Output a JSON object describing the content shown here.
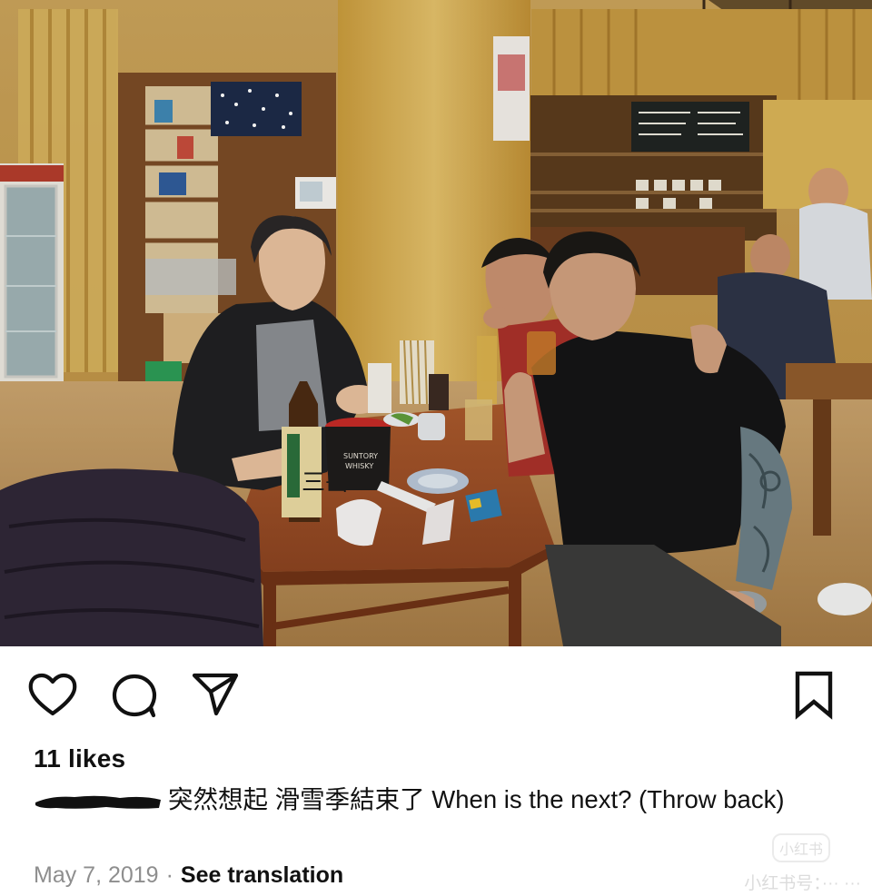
{
  "post": {
    "photo_alt": "",
    "likes_text": "11 likes",
    "caption_text": "突然想起 滑雪季結束了 When is the next? (Throw back)",
    "date": "May 7, 2019",
    "separator": "·",
    "see_translation": "See translation"
  },
  "photo_signage": {
    "bottle_label": "三岳",
    "cup_label": "SUNTORY\nWHISKY"
  },
  "watermark": {
    "badge": "小红书",
    "id_text": "小红书号：··· ···"
  },
  "icons": {
    "like": "heart-outline-icon",
    "comment": "speech-bubble-icon",
    "share": "paper-plane-icon",
    "save": "bookmark-icon"
  },
  "colors": {
    "icon_stroke": "#111111",
    "text_primary": "#111111",
    "text_secondary": "#8e8e8e",
    "background": "#ffffff"
  }
}
